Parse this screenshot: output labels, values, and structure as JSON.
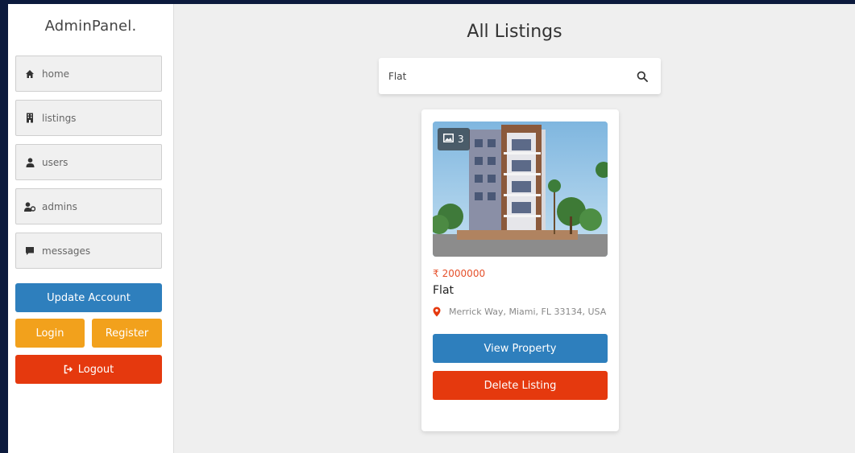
{
  "sidebar": {
    "brand": "AdminPanel.",
    "items": [
      {
        "label": "home",
        "icon": "home-icon"
      },
      {
        "label": "listings",
        "icon": "building-icon"
      },
      {
        "label": "users",
        "icon": "user-icon"
      },
      {
        "label": "admins",
        "icon": "user-gear-icon"
      },
      {
        "label": "messages",
        "icon": "comment-icon"
      }
    ],
    "update_label": "Update Account",
    "login_label": "Login",
    "register_label": "Register",
    "logout_label": "Logout"
  },
  "main": {
    "title": "All Listings",
    "search": {
      "value": "Flat",
      "icon": "search-icon"
    },
    "listing": {
      "image_count": "3",
      "currency": "₹",
      "price": "2000000",
      "title": "Flat",
      "address": "Merrick Way, Miami, FL 33134, USA",
      "view_label": "View Property",
      "delete_label": "Delete Listing"
    }
  },
  "colors": {
    "blue": "#2e7fbd",
    "orange": "#f2a11c",
    "red": "#e5390e",
    "price": "#e5502a",
    "background": "#0c1a3d"
  }
}
